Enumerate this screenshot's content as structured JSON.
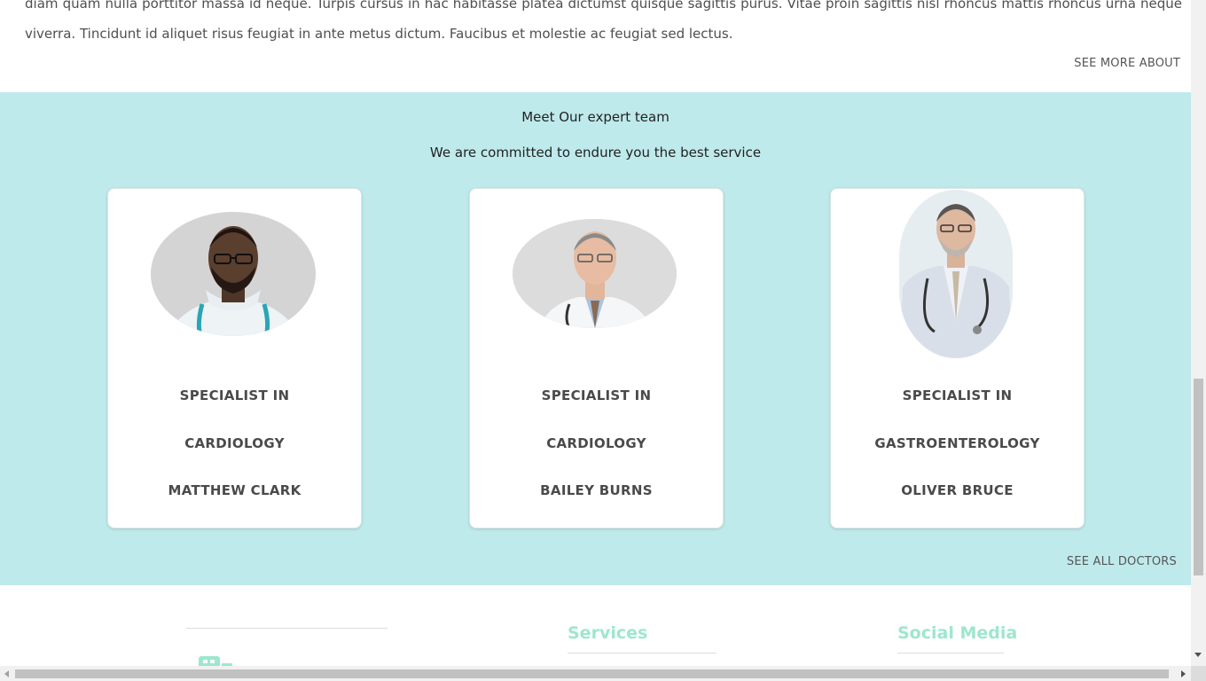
{
  "about": {
    "text": "diam quam nulla porttitor massa id neque. Turpis cursus in hac habitasse platea dictumst quisque sagittis purus. Vitae proin sagittis nisl rhoncus mattis rhoncus urna neque viverra. Tincidunt id aliquet risus feugiat in ante metus dictum. Faucibus et molestie ac feugiat sed lectus.",
    "see_more_label": "SEE MORE ABOUT"
  },
  "team": {
    "title": "Meet Our expert team",
    "subtitle": "We are committed to endure you the best service",
    "doctors": [
      {
        "line1": "SPECIALIST IN",
        "line2": "CARDIOLOGY",
        "name": "MATTHEW CLARK"
      },
      {
        "line1": "SPECIALIST IN",
        "line2": "CARDIOLOGY",
        "name": "BAILEY BURNS"
      },
      {
        "line1": "SPECIALIST IN",
        "line2": "GASTROENTEROLOGY",
        "name": "OLIVER BRUCE"
      }
    ],
    "see_all_label": "SEE ALL DOCTORS"
  },
  "footer": {
    "services_heading": "Services",
    "social_heading": "Social Media"
  },
  "colors": {
    "team_background": "#bfeaec",
    "footer_heading": "#9ee6cf"
  }
}
